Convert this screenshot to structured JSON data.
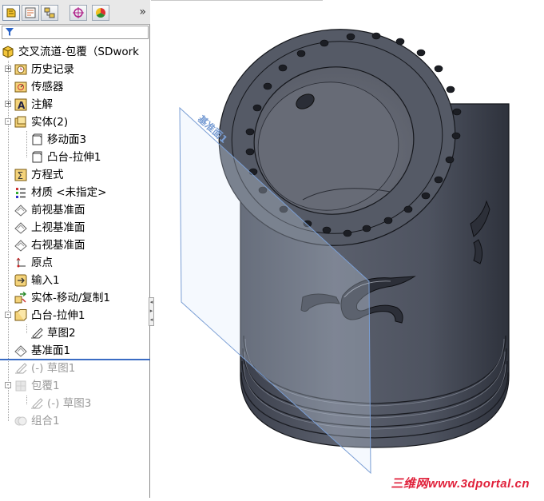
{
  "feature_manager": {
    "tabs": [
      {
        "name": "featuremanager-tab-icon"
      },
      {
        "name": "propertymanager-tab-icon"
      },
      {
        "name": "configurationmanager-tab-icon"
      },
      {
        "name": "dimxpert-tab-icon"
      },
      {
        "name": "display-manager-tab-icon"
      }
    ],
    "more_label": "»",
    "tree": [
      {
        "label": "交叉流道-包覆（SDwork",
        "icon": "part-icon"
      },
      {
        "label": "历史记录",
        "icon": "history-icon"
      },
      {
        "label": "传感器",
        "icon": "sensors-icon"
      },
      {
        "label": "注解",
        "icon": "annotations-icon"
      },
      {
        "label": "实体(2)",
        "icon": "solid-bodies-icon"
      },
      {
        "label": "移动面3",
        "icon": "body-icon"
      },
      {
        "label": "凸台-拉伸1",
        "icon": "body-icon"
      },
      {
        "label": "方程式",
        "icon": "equations-icon"
      },
      {
        "label": "材质 <未指定>",
        "icon": "material-icon"
      },
      {
        "label": "前视基准面",
        "icon": "plane-icon"
      },
      {
        "label": "上视基准面",
        "icon": "plane-icon"
      },
      {
        "label": "右视基准面",
        "icon": "plane-icon"
      },
      {
        "label": "原点",
        "icon": "origin-icon"
      },
      {
        "label": "输入1",
        "icon": "imported-icon"
      },
      {
        "label": "实体-移动/复制1",
        "icon": "move-copy-icon"
      },
      {
        "label": "凸台-拉伸1",
        "icon": "extrude-icon"
      },
      {
        "label": "草图2",
        "icon": "sketch-icon"
      },
      {
        "label": "基准面1",
        "icon": "plane-icon"
      },
      {
        "label": "(-) 草图1",
        "icon": "sketch-icon"
      },
      {
        "label": "包覆1",
        "icon": "wrap-icon"
      },
      {
        "label": "(-) 草图3",
        "icon": "sketch-icon"
      },
      {
        "label": "组合1",
        "icon": "combine-icon"
      }
    ]
  },
  "graphics": {
    "plane_label": "基准面1",
    "model_color": "#4a4f5c",
    "watermark": "三维网www.3dportal.cn"
  }
}
